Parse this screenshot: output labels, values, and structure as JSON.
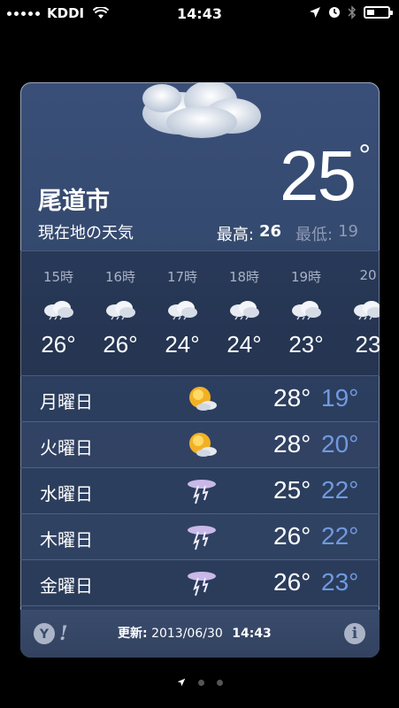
{
  "status_bar": {
    "carrier": "KDDI",
    "time": "14:43",
    "battery_level": 0.35
  },
  "weather": {
    "city": "尾道市",
    "description": "現在地の天気",
    "current_temp": "25",
    "degree": "°",
    "high_label": "最高:",
    "high_value": "26",
    "low_label": "最低:",
    "low_value": "19"
  },
  "hourly": [
    {
      "time": "15時",
      "temp": "26°",
      "icon": "cloudy-rain-icon"
    },
    {
      "time": "16時",
      "temp": "26°",
      "icon": "cloudy-rain-icon"
    },
    {
      "time": "17時",
      "temp": "24°",
      "icon": "cloudy-rain-icon"
    },
    {
      "time": "18時",
      "temp": "24°",
      "icon": "cloudy-rain-icon"
    },
    {
      "time": "19時",
      "temp": "23°",
      "icon": "cloudy-rain-icon"
    },
    {
      "time": "20",
      "temp": "23",
      "icon": "cloudy-rain-icon"
    }
  ],
  "daily": [
    {
      "day": "月曜日",
      "high": "28°",
      "low": "19°",
      "icon": "sun-cloud-icon"
    },
    {
      "day": "火曜日",
      "high": "28°",
      "low": "20°",
      "icon": "sun-cloud-icon"
    },
    {
      "day": "水曜日",
      "high": "25°",
      "low": "22°",
      "icon": "thunderstorm-icon"
    },
    {
      "day": "木曜日",
      "high": "26°",
      "low": "22°",
      "icon": "thunderstorm-icon"
    },
    {
      "day": "金曜日",
      "high": "26°",
      "low": "23°",
      "icon": "thunderstorm-icon"
    }
  ],
  "footer": {
    "updated_label": "更新:",
    "updated_date": "2013/06/30",
    "updated_time": "14:43",
    "info_glyph": "i"
  },
  "colors": {
    "low_temp": "#6f9ae0",
    "card_bg": "#34496e"
  }
}
